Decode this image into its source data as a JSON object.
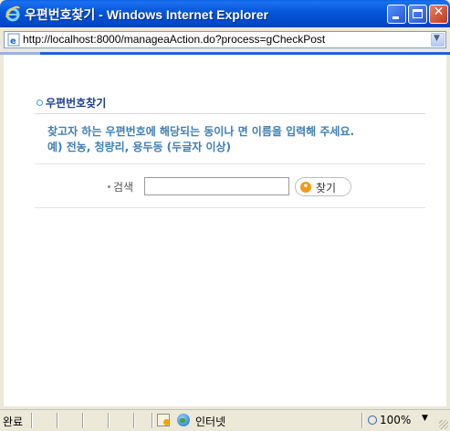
{
  "window": {
    "title": "우편번호찾기 - Windows Internet Explorer",
    "accent_color": "#0455d8"
  },
  "address_bar": {
    "url": "http://localhost:8000/manageaAction.do?process=gCheckPost"
  },
  "content": {
    "section_title": "우편번호찾기",
    "description_line1": "찾고자 하는 우편번호에 해당되는 동이나 면 이름을 입력해 주세요.",
    "description_line2": "예) 전농, 청량리, 용두동 (두글자 이상)",
    "search_label": "검색",
    "search_value": "",
    "find_button_label": "찾기"
  },
  "status_bar": {
    "status_text": "완료",
    "zone_label": "인터넷",
    "zoom_level": "100%"
  }
}
